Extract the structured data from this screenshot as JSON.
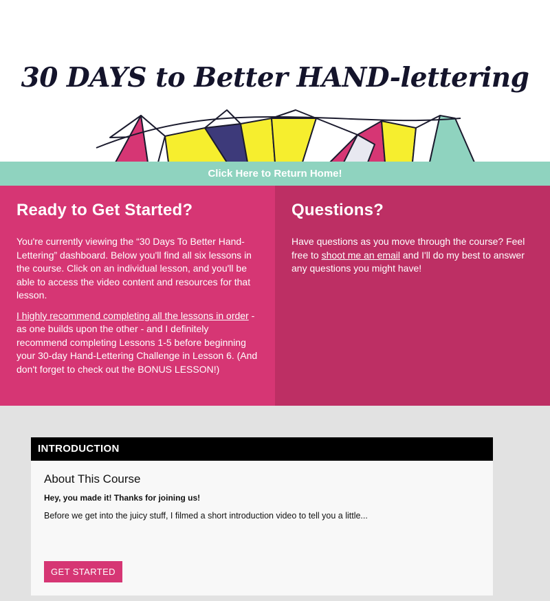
{
  "hero": {
    "title": "30 DAYS to Better HAND-lettering"
  },
  "return_link": "Click Here to Return Home!",
  "left_panel": {
    "heading": "Ready to Get Started?",
    "intro": "You're currently viewing the “30 Days To Better Hand-Lettering” dashboard. Below you'll find all six lessons in the course. Click on an individual lesson, and you'll be able to access the video content and resources for that lesson.",
    "recommend_link": "I highly recommend completing all the lessons in order",
    "recommend_rest": " - as one builds upon the other - and I definitely recommend completing Lessons 1-5 before beginning your 30-day Hand-Lettering Challenge in Lesson 6. (And don't forget to check out the BONUS LESSON!)"
  },
  "right_panel": {
    "heading": "Questions?",
    "text_before": "Have questions as you move through the course? Feel free to ",
    "email_link": "shoot me an email",
    "text_after": " and I'll do my best to answer any questions you might have!"
  },
  "lesson_card": {
    "header": "INTRODUCTION",
    "title": "About This Course",
    "subtitle": "Hey, you made it! Thanks for joining us!",
    "description": "Before we get into the juicy stuff, I filmed a short introduction video to tell you a little...",
    "button_label": "GET STARTED"
  },
  "colors": {
    "mint": "#8fd3bf",
    "pink": "#d63674",
    "magenta": "#bd2f64",
    "gray": "#e2e2e2",
    "yellow": "#f6ee2e"
  }
}
